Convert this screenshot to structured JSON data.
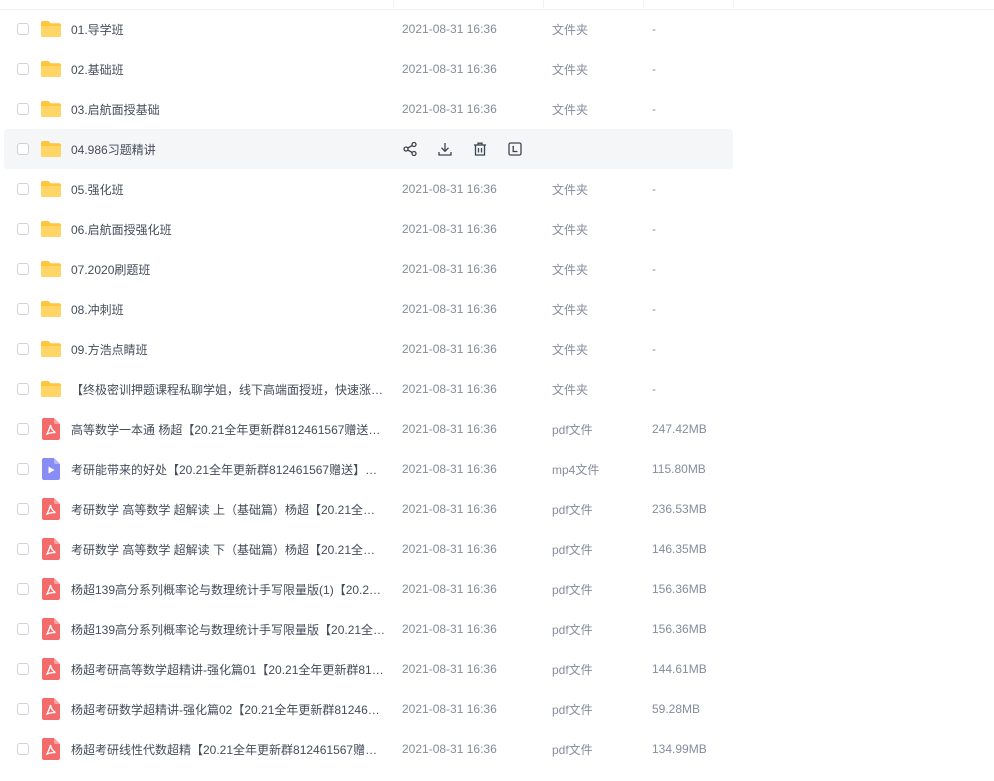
{
  "actions": {
    "share_label": "share",
    "download_label": "download",
    "delete_label": "delete",
    "more_label": "more"
  },
  "colors": {
    "folder": "#ffc53d",
    "pdf": "#f46b6b",
    "mp4": "#8a8cf6",
    "hover_bg": "#f5f6f8"
  },
  "files": [
    {
      "name": "01.导学班",
      "time": "2021-08-31 16:36",
      "type": "文件夹",
      "size": "-",
      "icon": "folder-icon",
      "hover": false
    },
    {
      "name": "02.基础班",
      "time": "2021-08-31 16:36",
      "type": "文件夹",
      "size": "-",
      "icon": "folder-icon",
      "hover": false
    },
    {
      "name": "03.启航面授基础",
      "time": "2021-08-31 16:36",
      "type": "文件夹",
      "size": "-",
      "icon": "folder-icon",
      "hover": false
    },
    {
      "name": "04.986习题精讲",
      "time": "",
      "type": "",
      "size": "",
      "icon": "folder-icon",
      "hover": true
    },
    {
      "name": "05.强化班",
      "time": "2021-08-31 16:36",
      "type": "文件夹",
      "size": "-",
      "icon": "folder-icon",
      "hover": false
    },
    {
      "name": "06.启航面授强化班",
      "time": "2021-08-31 16:36",
      "type": "文件夹",
      "size": "-",
      "icon": "folder-icon",
      "hover": false
    },
    {
      "name": "07.2020刷题班",
      "time": "2021-08-31 16:36",
      "type": "文件夹",
      "size": "-",
      "icon": "folder-icon",
      "hover": false
    },
    {
      "name": "08.冲刺班",
      "time": "2021-08-31 16:36",
      "type": "文件夹",
      "size": "-",
      "icon": "folder-icon",
      "hover": false
    },
    {
      "name": "09.方浩点睛班",
      "time": "2021-08-31 16:36",
      "type": "文件夹",
      "size": "-",
      "icon": "folder-icon",
      "hover": false
    },
    {
      "name": "【终极密训押题课程私聊学姐，线下高端面授班，快速涨…",
      "time": "2021-08-31 16:36",
      "type": "文件夹",
      "size": "-",
      "icon": "folder-icon",
      "hover": false
    },
    {
      "name": "高等数学一本通 杨超【20.21全年更新群812461567赠送…",
      "time": "2021-08-31 16:36",
      "type": "pdf文件",
      "size": "247.42MB",
      "icon": "pdf-icon",
      "hover": false
    },
    {
      "name": "考研能带来的好处【20.21全年更新群812461567赠送】…",
      "time": "2021-08-31 16:36",
      "type": "mp4文件",
      "size": "115.80MB",
      "icon": "video-icon",
      "hover": false
    },
    {
      "name": "考研数学 高等数学 超解读 上（基础篇）杨超【20.21全…",
      "time": "2021-08-31 16:36",
      "type": "pdf文件",
      "size": "236.53MB",
      "icon": "pdf-icon",
      "hover": false
    },
    {
      "name": "考研数学 高等数学 超解读 下（基础篇）杨超【20.21全…",
      "time": "2021-08-31 16:36",
      "type": "pdf文件",
      "size": "146.35MB",
      "icon": "pdf-icon",
      "hover": false
    },
    {
      "name": "杨超139高分系列概率论与数理统计手写限量版(1)【20.2…",
      "time": "2021-08-31 16:36",
      "type": "pdf文件",
      "size": "156.36MB",
      "icon": "pdf-icon",
      "hover": false
    },
    {
      "name": "杨超139高分系列概率论与数理统计手写限量版【20.21全…",
      "time": "2021-08-31 16:36",
      "type": "pdf文件",
      "size": "156.36MB",
      "icon": "pdf-icon",
      "hover": false
    },
    {
      "name": "杨超考研高等数学超精讲-强化篇01【20.21全年更新群81…",
      "time": "2021-08-31 16:36",
      "type": "pdf文件",
      "size": "144.61MB",
      "icon": "pdf-icon",
      "hover": false
    },
    {
      "name": "杨超考研数学超精讲-强化篇02【20.21全年更新群81246…",
      "time": "2021-08-31 16:36",
      "type": "pdf文件",
      "size": "59.28MB",
      "icon": "pdf-icon",
      "hover": false
    },
    {
      "name": "杨超考研线性代数超精【20.21全年更新群812461567赠…",
      "time": "2021-08-31 16:36",
      "type": "pdf文件",
      "size": "134.99MB",
      "icon": "pdf-icon",
      "hover": false
    }
  ]
}
